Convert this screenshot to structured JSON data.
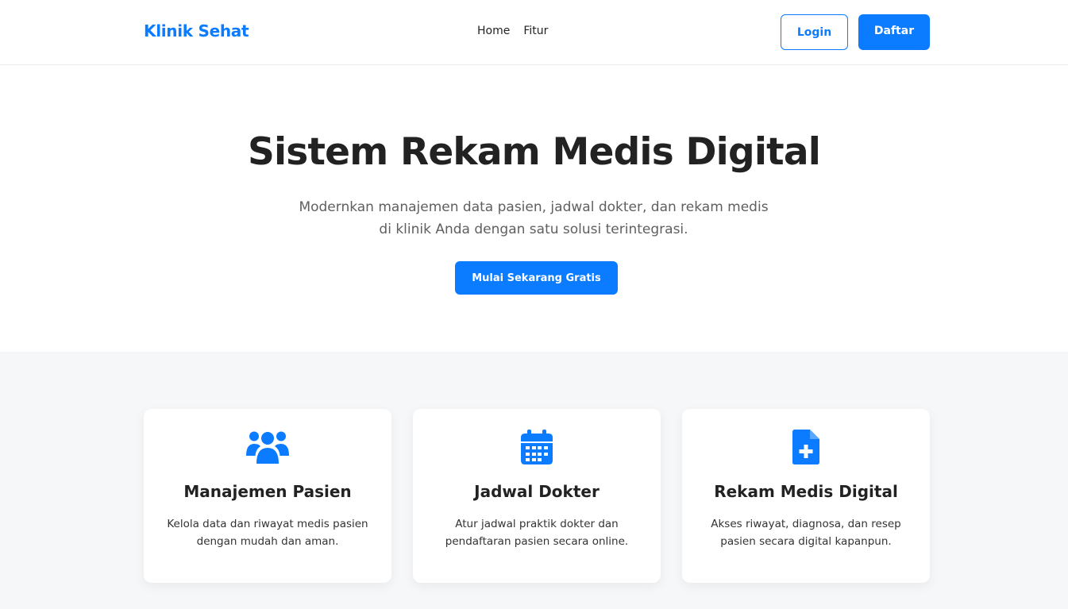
{
  "nav": {
    "brand": "Klinik Sehat",
    "links": [
      "Home",
      "Fitur"
    ],
    "login_label": "Login",
    "register_label": "Daftar"
  },
  "hero": {
    "title": "Sistem Rekam Medis Digital",
    "subtitle": "Modernkan manajemen data pasien, jadwal dokter, dan rekam medis di klinik Anda dengan satu solusi terintegrasi.",
    "cta_label": "Mulai Sekarang Gratis"
  },
  "features": [
    {
      "icon": "users-icon",
      "title": "Manajemen Pasien",
      "description": "Kelola data dan riwayat medis pasien dengan mudah dan aman."
    },
    {
      "icon": "calendar-icon",
      "title": "Jadwal Dokter",
      "description": "Atur jadwal praktik dokter dan pendaftaran pasien secara online."
    },
    {
      "icon": "medical-file-icon",
      "title": "Rekam Medis Digital",
      "description": "Akses riwayat, diagnosa, dan resep pasien secara digital kapanpun."
    }
  ],
  "colors": {
    "primary": "#0b7bff",
    "text": "#222222",
    "muted": "#5f5f5f",
    "section_bg": "#f6f7f9"
  }
}
